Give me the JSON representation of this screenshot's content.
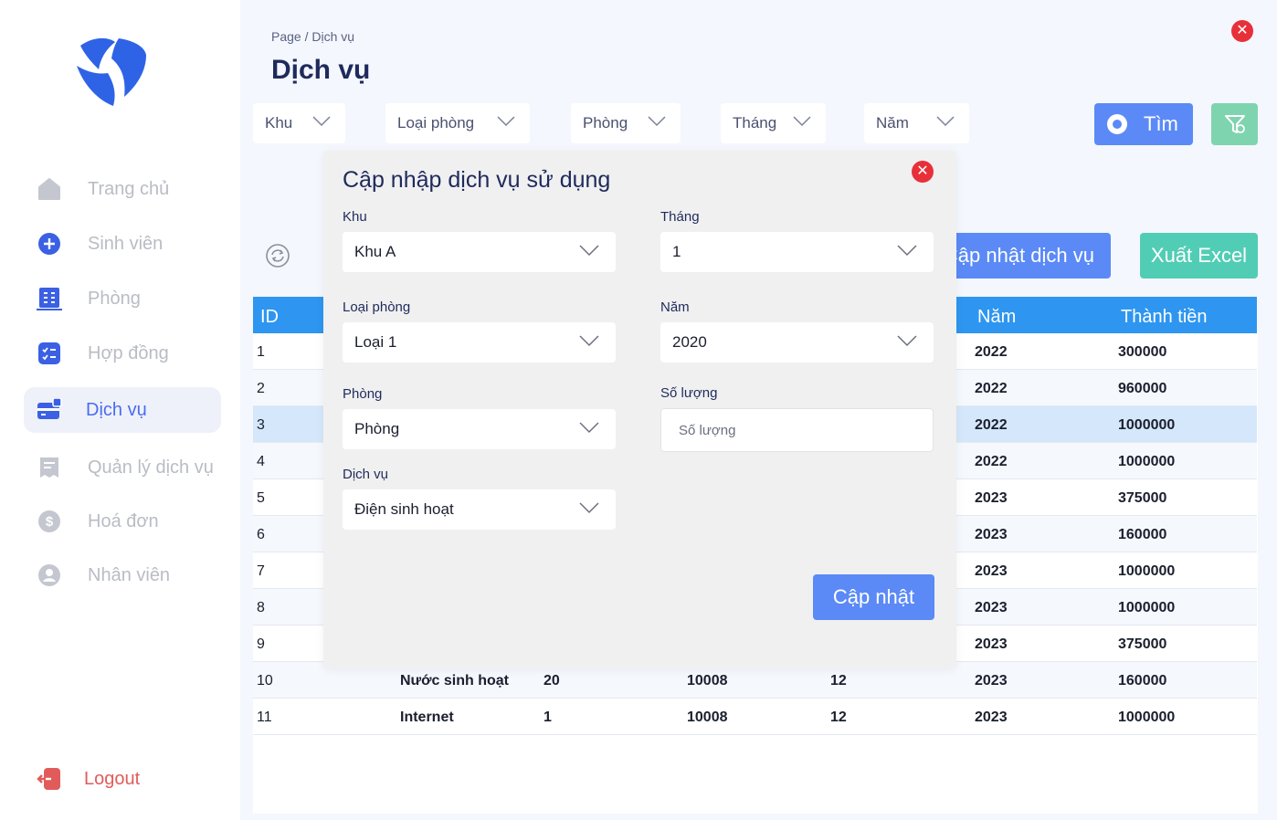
{
  "sidebar": {
    "items": [
      {
        "label": "Trang chủ",
        "icon": "home-icon"
      },
      {
        "label": "Sinh viên",
        "icon": "plus-circle-icon"
      },
      {
        "label": "Phòng",
        "icon": "building-icon"
      },
      {
        "label": "Hợp đồng",
        "icon": "checklist-icon"
      },
      {
        "label": "Dịch vụ",
        "icon": "service-card-icon"
      },
      {
        "label": "Quản lý dịch vụ",
        "icon": "receipt-icon"
      },
      {
        "label": "Hoá đơn",
        "icon": "dollar-icon"
      },
      {
        "label": "Nhân viên",
        "icon": "user-icon"
      }
    ],
    "active_item": "Dịch vụ",
    "logout_label": "Logout"
  },
  "header": {
    "breadcrumb": "Page / Dịch vụ",
    "title": "Dịch vụ"
  },
  "filters": {
    "khu": "Khu",
    "loai_phong": "Loại phòng",
    "phong": "Phòng",
    "thang": "Tháng",
    "nam": "Năm"
  },
  "actions": {
    "find_label": "Tìm",
    "update_service_label": "Cập nhật dịch vụ",
    "export_excel_label": "Xuất Excel"
  },
  "table": {
    "columns": [
      "ID",
      "Năm",
      "Thành tiền"
    ],
    "rows": [
      {
        "id": "1",
        "nam": "2022",
        "thanh_tien": "300000"
      },
      {
        "id": "2",
        "nam": "2022",
        "thanh_tien": "960000"
      },
      {
        "id": "3",
        "nam": "2022",
        "thanh_tien": "1000000"
      },
      {
        "id": "4",
        "nam": "2022",
        "thanh_tien": "1000000"
      },
      {
        "id": "5",
        "nam": "2023",
        "thanh_tien": "375000"
      },
      {
        "id": "6",
        "nam": "2023",
        "thanh_tien": "160000"
      },
      {
        "id": "7",
        "nam": "2023",
        "thanh_tien": "1000000"
      },
      {
        "id": "8",
        "nam": "2023",
        "thanh_tien": "1000000"
      },
      {
        "id": "9",
        "nam": "2023",
        "thanh_tien": "375000"
      },
      {
        "id": "10",
        "service": "Nước sinh hoạt",
        "qty": "20",
        "room": "10008",
        "month": "12",
        "nam": "2023",
        "thanh_tien": "160000"
      },
      {
        "id": "11",
        "service": "Internet",
        "qty": "1",
        "room": "10008",
        "month": "12",
        "nam": "2023",
        "thanh_tien": "1000000"
      }
    ],
    "selected_row_id": "3"
  },
  "modal": {
    "title": "Cập nhập dịch vụ sử dụng",
    "khu_label": "Khu",
    "khu_value": "Khu A",
    "loai_phong_label": "Loại phòng",
    "loai_phong_value": "Loại 1",
    "phong_label": "Phòng",
    "phong_value": "Phòng",
    "dich_vu_label": "Dịch vụ",
    "dich_vu_value": "Điện sinh hoạt",
    "thang_label": "Tháng",
    "thang_value": "1",
    "nam_label": "Năm",
    "nam_value": "2020",
    "so_luong_label": "Số lượng",
    "so_luong_placeholder": "Số lượng",
    "save_label": "Cập nhật"
  },
  "colors": {
    "accent": "#5b8af7",
    "table_header": "#2e96f0",
    "excel": "#52cdb5",
    "close": "#e8303a",
    "logout": "#e25b5b"
  }
}
